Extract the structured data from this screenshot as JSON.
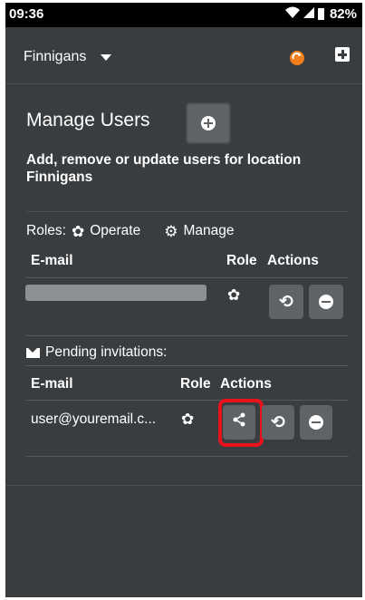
{
  "status_bar": {
    "time": "09:36",
    "battery": "82%"
  },
  "app_bar": {
    "location": "Finnigans",
    "sync_icon": "sync-icon",
    "add_icon": "plus-box-icon"
  },
  "page": {
    "title": "Manage Users",
    "subtitle": "Add, remove or update users for location Finnigans"
  },
  "roles": {
    "label": "Roles:",
    "operate": "Operate",
    "manage": "Manage"
  },
  "users_table": {
    "headers": {
      "email": "E-mail",
      "role": "Role",
      "actions": "Actions"
    },
    "rows": [
      {
        "email_redacted": true,
        "role_icon": "gear-icon",
        "actions": [
          "refresh-icon",
          "minus-circle-icon"
        ]
      }
    ]
  },
  "pending": {
    "label": "Pending invitations:",
    "headers": {
      "email": "E-mail",
      "role": "Role",
      "actions": "Actions"
    },
    "rows": [
      {
        "email": "user@youremail.c...",
        "role_icon": "gear-icon",
        "actions": [
          "share-icon",
          "refresh-icon",
          "minus-circle-icon"
        ]
      }
    ]
  },
  "colors": {
    "background": "#3a3d40",
    "button": "#5f6368",
    "highlight": "#e8131a",
    "sync_accent": "#f07e1b"
  }
}
